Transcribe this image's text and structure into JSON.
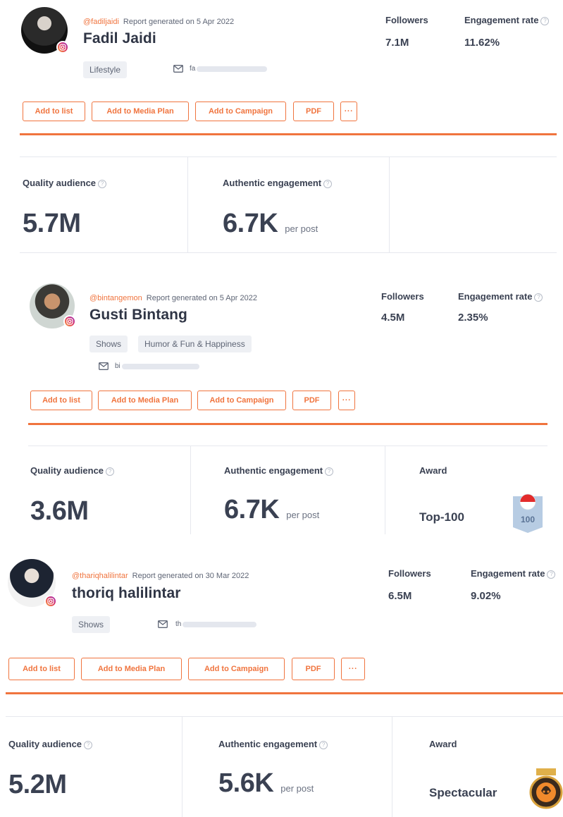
{
  "profiles": [
    {
      "handle": "@fadiljaidi",
      "report": "Report generated on 5 Apr 2022",
      "name": "Fadil Jaidi",
      "followers_label": "Followers",
      "followers": "7.1M",
      "engagement_label": "Engagement rate",
      "engagement": "11.62%",
      "tags": [
        "Lifestyle"
      ],
      "email_prefix": "fa",
      "buttons": [
        "Add to list",
        "Add to Media Plan",
        "Add to Campaign",
        "PDF",
        "···"
      ],
      "quality_label": "Quality audience",
      "quality": "5.7M",
      "authentic_label": "Authentic engagement",
      "authentic": "6.7K",
      "per_post": "per post"
    },
    {
      "handle": "@bintangemon",
      "report": "Report generated on 5 Apr 2022",
      "name": "Gusti Bintang",
      "followers_label": "Followers",
      "followers": "4.5M",
      "engagement_label": "Engagement rate",
      "engagement": "2.35%",
      "tags": [
        "Shows",
        "Humor & Fun & Happiness"
      ],
      "email_prefix": "bi",
      "buttons": [
        "Add to list",
        "Add to Media Plan",
        "Add to Campaign",
        "PDF",
        "···"
      ],
      "quality_label": "Quality audience",
      "quality": "3.6M",
      "authentic_label": "Authentic engagement",
      "authentic": "6.7K",
      "per_post": "per post",
      "award_label": "Award",
      "award": "Top-100",
      "award_badge_number": "100"
    },
    {
      "handle": "@thariqhalilintar",
      "report": "Report generated on 30 Mar 2022",
      "name": "thoriq halilintar",
      "followers_label": "Followers",
      "followers": "6.5M",
      "engagement_label": "Engagement rate",
      "engagement": "9.02%",
      "tags": [
        "Shows"
      ],
      "email_prefix": "th",
      "buttons": [
        "Add to list",
        "Add to Media Plan",
        "Add to Campaign",
        "PDF",
        "···"
      ],
      "quality_label": "Quality audience",
      "quality": "5.2M",
      "authentic_label": "Authentic engagement",
      "authentic": "5.6K",
      "per_post": "per post",
      "award_label": "Award",
      "award": "Spectacular"
    }
  ],
  "help_glyph": "?",
  "colors": {
    "accent": "#f0743e",
    "text": "#3a4152",
    "tag_bg": "#eef0f4"
  },
  "icons": [
    "instagram-icon",
    "mail-icon",
    "help-icon",
    "award-badge-icon",
    "spectacular-medal-icon"
  ]
}
